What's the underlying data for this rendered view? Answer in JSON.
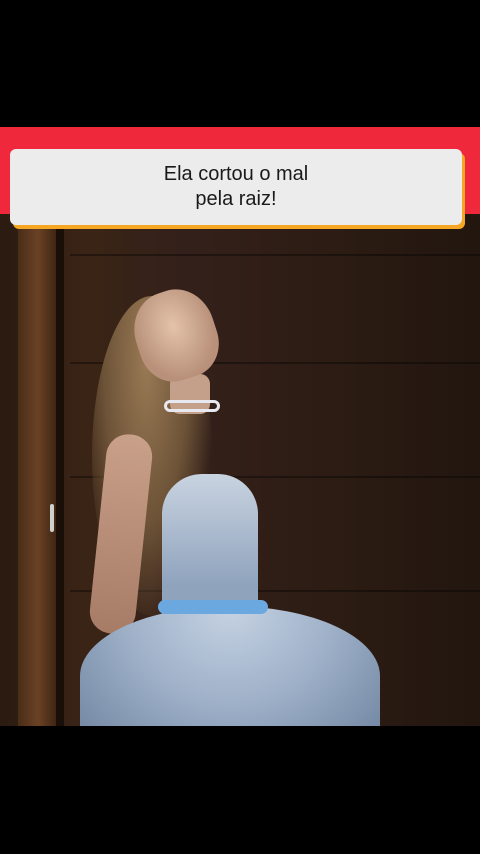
{
  "caption": {
    "line1": "Ela cortou o mal",
    "line2": "pela raiz!"
  },
  "colors": {
    "banner_red": "#f0283c",
    "card_background": "#ececec",
    "card_shadow_orange": "#f5a623",
    "letterbox": "#000000"
  },
  "video": {
    "scene": "woman-in-light-blue-gown-leaning-against-wood-panel-wall"
  }
}
